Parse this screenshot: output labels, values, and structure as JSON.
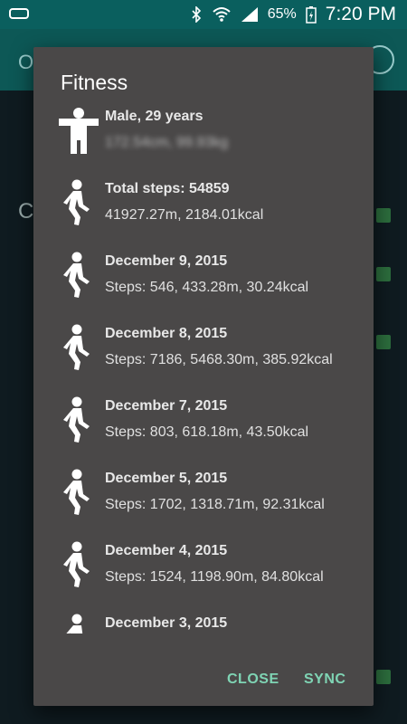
{
  "status_bar": {
    "battery": "65%",
    "time": "7:20 PM"
  },
  "dialog": {
    "title": "Fitness",
    "profile": {
      "line1": "Male, 29 years",
      "line2": "172.54cm, 99.93kg"
    },
    "items": [
      {
        "line1": "Total steps: 54859",
        "line2": "41927.27m, 2184.01kcal"
      },
      {
        "line1": "December 9, 2015",
        "line2": "Steps: 546, 433.28m, 30.24kcal"
      },
      {
        "line1": "December 8, 2015",
        "line2": "Steps: 7186, 5468.30m, 385.92kcal"
      },
      {
        "line1": "December 7, 2015",
        "line2": "Steps: 803, 618.18m, 43.50kcal"
      },
      {
        "line1": "December 5, 2015",
        "line2": "Steps: 1702, 1318.71m, 92.31kcal"
      },
      {
        "line1": "December 4, 2015",
        "line2": "Steps: 1524, 1198.90m, 84.80kcal"
      },
      {
        "line1": "December 3, 2015",
        "line2": ""
      }
    ],
    "buttons": {
      "close": "CLOSE",
      "sync": "SYNC"
    }
  }
}
